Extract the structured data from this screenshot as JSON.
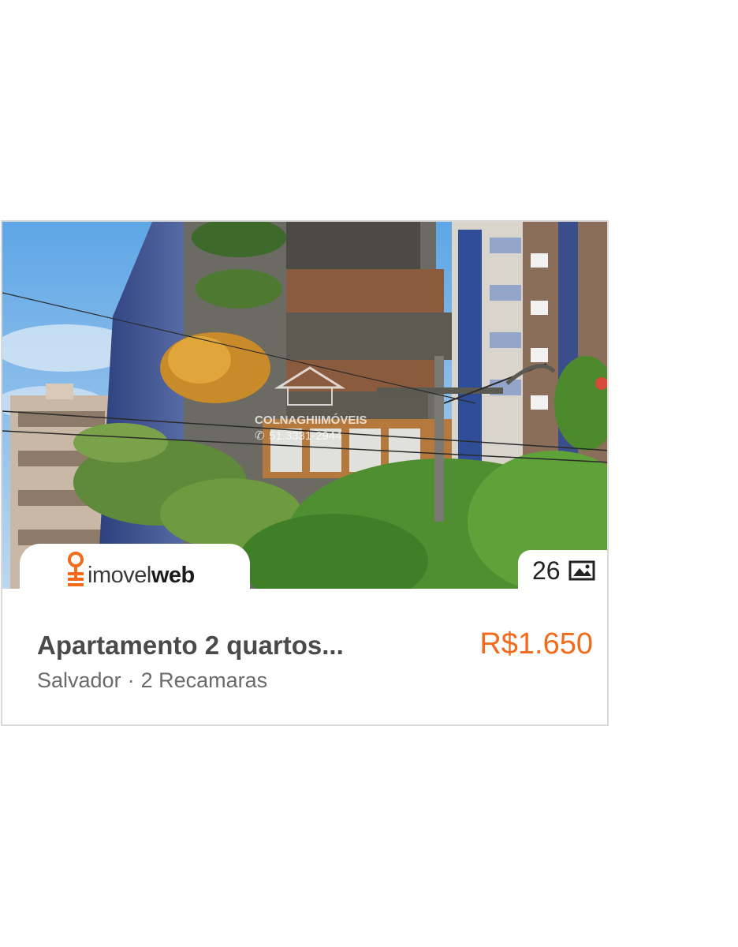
{
  "listing": {
    "title": "Apartamento 2 quartos...",
    "price": "R$1.650",
    "city": "Salvador",
    "separator": "·",
    "bedrooms": "2 Recamaras",
    "photo_count": "26",
    "photo_watermark": "COLNAGHIIMÓVEIS",
    "photo_watermark_phone": "51.3331-2944"
  },
  "brand": {
    "logo_light": "imovel",
    "logo_bold": "web",
    "accent_color": "#f26a1b"
  },
  "icons": {
    "logo": "key-pin-icon",
    "gallery": "image-icon"
  }
}
